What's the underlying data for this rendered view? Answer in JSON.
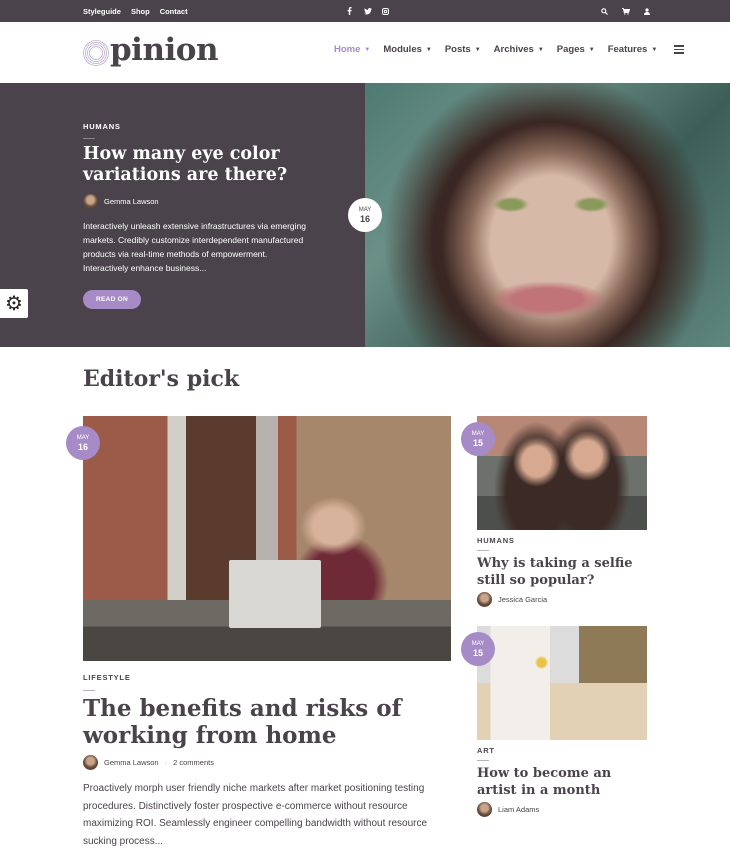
{
  "topbar": {
    "links": [
      "Styleguide",
      "Shop",
      "Contact"
    ],
    "social_icons": [
      "facebook-icon",
      "twitter-icon",
      "instagram-icon"
    ],
    "utility_icons": [
      "search-icon",
      "cart-icon",
      "user-icon"
    ]
  },
  "header": {
    "logo_text": "pinion",
    "logo_full": "Opinion",
    "nav": [
      {
        "label": "Home",
        "active": true
      },
      {
        "label": "Modules",
        "active": false
      },
      {
        "label": "Posts",
        "active": false
      },
      {
        "label": "Archives",
        "active": false
      },
      {
        "label": "Pages",
        "active": false
      },
      {
        "label": "Features",
        "active": false
      }
    ],
    "menu_icon": "hamburger-icon"
  },
  "hero": {
    "category": "HUMANS",
    "title": "How many eye color variations are there?",
    "author": "Gemma Lawson",
    "excerpt": "Interactively unleash extensive infrastructures via emerging markets. Credibly customize interdependent manufactured products via real-time methods of empowerment. Interactively enhance business...",
    "button_label": "READ ON",
    "date": {
      "month": "MAY",
      "day": "16"
    }
  },
  "settings_icon": "gear-icon",
  "editors_pick": {
    "title": "Editor's pick",
    "main_post": {
      "date": {
        "month": "MAY",
        "day": "16"
      },
      "category": "LIFESTYLE",
      "title": "The benefits and risks of working from home",
      "author": "Gemma Lawson",
      "separator": "·",
      "comments": "2 comments",
      "excerpt": "Proactively morph user friendly niche markets after market positioning testing procedures. Distinctively foster prospective e-commerce without resource maximizing ROI. Seamlessly engineer compelling bandwidth without resource sucking process..."
    },
    "side_posts": [
      {
        "date": {
          "month": "MAY",
          "day": "15"
        },
        "category": "HUMANS",
        "title": "Why is taking a selfie still so popular?",
        "author": "Jessica Garcia"
      },
      {
        "date": {
          "month": "MAY",
          "day": "15"
        },
        "category": "ART",
        "title": "How to become an artist in a month",
        "author": "Liam Adams"
      }
    ]
  },
  "colors": {
    "dark": "#4a434b",
    "accent": "#a68bc7",
    "white": "#ffffff"
  }
}
